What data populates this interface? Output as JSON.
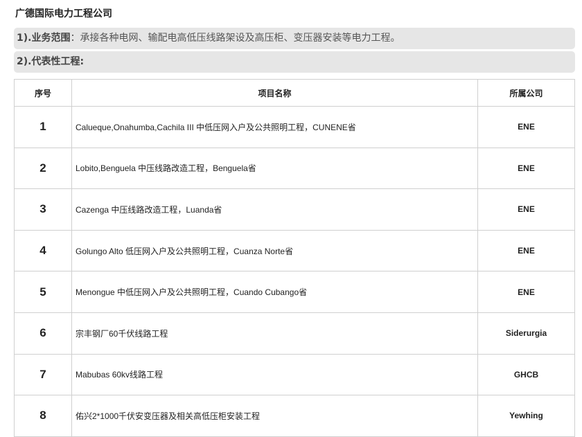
{
  "header": {
    "title": "广德国际电力工程公司"
  },
  "scope": {
    "label": "1).业务范围",
    "text": "：承接各种电网、输配电高低压线路架设及高压柜、变压器安装等电力工程。"
  },
  "projects_heading": {
    "label": "2).代表性工程:"
  },
  "table": {
    "columns": [
      "序号",
      "项目名称",
      "所属公司"
    ],
    "rows": [
      {
        "no": "1",
        "name": "Calueque,Onahumba,Cachila III 中低压网入户及公共照明工程，CUNENE省",
        "company": "ENE"
      },
      {
        "no": "2",
        "name": "Lobito,Benguela 中压线路改造工程，Benguela省",
        "company": "ENE"
      },
      {
        "no": "3",
        "name": "Cazenga 中压线路改造工程，Luanda省",
        "company": "ENE"
      },
      {
        "no": "4",
        "name": "Golungo Alto 低压网入户及公共照明工程，Cuanza Norte省",
        "company": "ENE"
      },
      {
        "no": "5",
        "name": "Menongue 中低压网入户及公共照明工程，Cuando Cubango省",
        "company": "ENE"
      },
      {
        "no": "6",
        "name": "宗丰钢厂60千伏线路工程",
        "company": "Siderurgia"
      },
      {
        "no": "7",
        "name": "Mabubas 60kv线路工程",
        "company": "GHCB"
      },
      {
        "no": "8",
        "name": "佑兴2*1000千伏安变压器及相关高低压柜安装工程",
        "company": "Yewhing"
      }
    ]
  }
}
